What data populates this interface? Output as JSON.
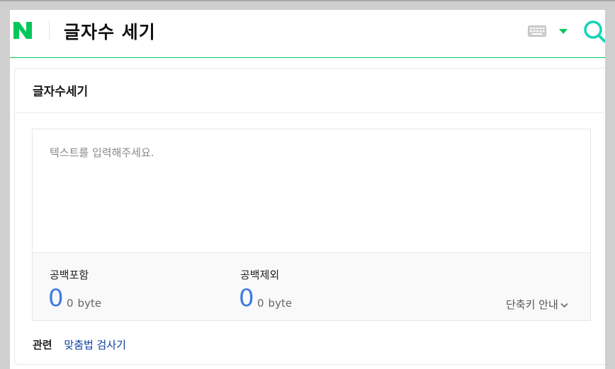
{
  "header": {
    "logo_letter": "N",
    "title": "글자수 세기",
    "icons": [
      "keyboard-icon",
      "dropdown-arrow-icon",
      "search-icon"
    ],
    "brand_color": "#03c75a"
  },
  "card": {
    "title": "글자수세기",
    "input": {
      "placeholder": "텍스트를 입력해주세요.",
      "value": ""
    },
    "stats": {
      "with_spaces": {
        "label": "공백포함",
        "count": "0",
        "bytes": "0",
        "unit": "byte"
      },
      "without_spaces": {
        "label": "공백제외",
        "count": "0",
        "bytes": "0",
        "unit": "byte"
      }
    },
    "shortcut_label": "단축키 안내",
    "count_color": "#3f7be0"
  },
  "related": {
    "label": "관련",
    "link": "맞춤법 검사기"
  }
}
